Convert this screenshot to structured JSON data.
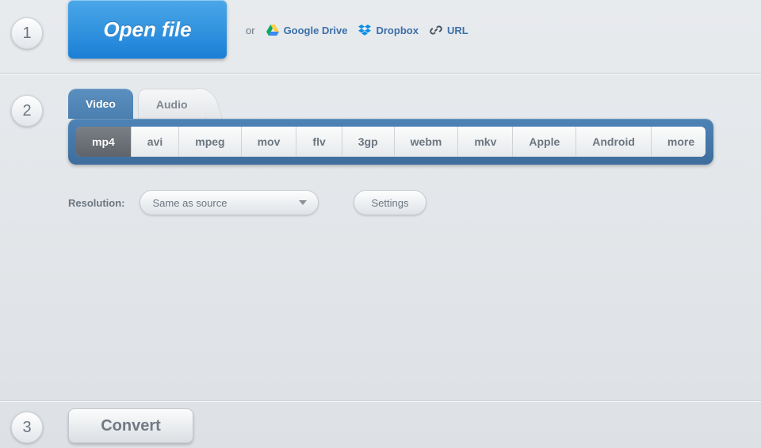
{
  "step_badges": {
    "one": "1",
    "two": "2",
    "three": "3"
  },
  "step1": {
    "open_file_label": "Open file",
    "or_label": "or",
    "google_drive_label": "Google Drive",
    "dropbox_label": "Dropbox",
    "url_label": "URL"
  },
  "step2": {
    "tabs": {
      "video": "Video",
      "audio": "Audio",
      "active": "video"
    },
    "formats": [
      {
        "id": "mp4",
        "label": "mp4",
        "selected": true
      },
      {
        "id": "avi",
        "label": "avi",
        "selected": false
      },
      {
        "id": "mpeg",
        "label": "mpeg",
        "selected": false
      },
      {
        "id": "mov",
        "label": "mov",
        "selected": false
      },
      {
        "id": "flv",
        "label": "flv",
        "selected": false
      },
      {
        "id": "3gp",
        "label": "3gp",
        "selected": false
      },
      {
        "id": "webm",
        "label": "webm",
        "selected": false
      },
      {
        "id": "mkv",
        "label": "mkv",
        "selected": false
      },
      {
        "id": "apple",
        "label": "Apple",
        "selected": false
      },
      {
        "id": "android",
        "label": "Android",
        "selected": false
      },
      {
        "id": "more",
        "label": "more",
        "selected": false
      }
    ],
    "resolution_label": "Resolution:",
    "resolution_value": "Same as source",
    "settings_label": "Settings"
  },
  "step3": {
    "convert_label": "Convert"
  }
}
